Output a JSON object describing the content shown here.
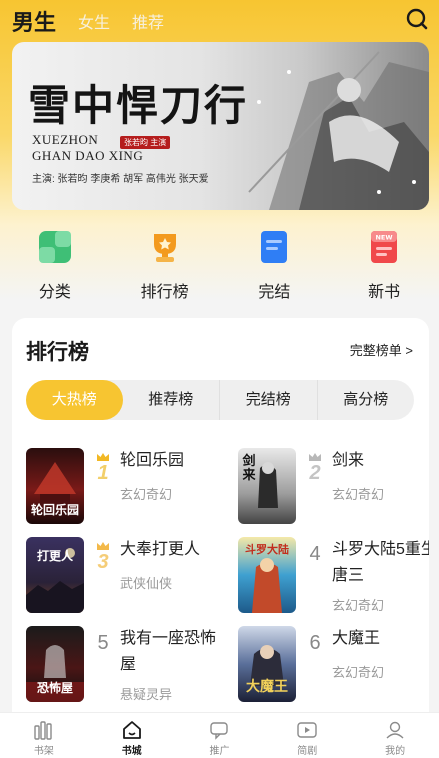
{
  "top_tabs": [
    {
      "label": "男生",
      "active": true
    },
    {
      "label": "女生",
      "active": false
    },
    {
      "label": "推荐",
      "active": false
    }
  ],
  "banner": {
    "title": "雪中悍刀行",
    "en_line1": "XUEZHON",
    "en_line2": "GHAN DAO XING",
    "stamp": "张若昀 主演",
    "cast": "主演: 张若昀 李庚希 胡军 高伟光 张天爱",
    "dots": 3,
    "active_dot": 0
  },
  "shortcuts": [
    {
      "label": "分类",
      "icon": "grid-icon",
      "color": "#3fbf76"
    },
    {
      "label": "排行榜",
      "icon": "trophy-icon",
      "color": "#f39a1e"
    },
    {
      "label": "完结",
      "icon": "document-icon",
      "color": "#2f7ef5"
    },
    {
      "label": "新书",
      "icon": "new-book-icon",
      "color": "#f0484a"
    }
  ],
  "ranking": {
    "title": "排行榜",
    "more": "完整榜单 >",
    "tabs": [
      "大热榜",
      "推荐榜",
      "完结榜",
      "高分榜"
    ],
    "active_tab": 0,
    "books": [
      {
        "rank": "1",
        "name": "轮回乐园",
        "genre": "玄幻奇幻",
        "cover_text": "轮回乐园",
        "crown": "gold"
      },
      {
        "rank": "2",
        "name": "剑来",
        "genre": "玄幻奇幻",
        "cover_text": "剑来",
        "crown": "silver"
      },
      {
        "rank": "3",
        "name": "大奉打更人",
        "genre": "武侠仙侠",
        "cover_text": "打更人",
        "crown": "bronze"
      },
      {
        "rank": "4",
        "name": "斗罗大陆5重生唐三",
        "genre": "玄幻奇幻",
        "cover_text": "斗罗大陆",
        "crown": ""
      },
      {
        "rank": "5",
        "name": "我有一座恐怖屋",
        "genre": "悬疑灵异",
        "cover_text": "恐怖屋",
        "crown": ""
      },
      {
        "rank": "6",
        "name": "大魔王",
        "genre": "玄幻奇幻",
        "cover_text": "大魔王",
        "crown": ""
      }
    ]
  },
  "navbar": [
    {
      "label": "书架",
      "icon": "bookshelf-icon",
      "active": false
    },
    {
      "label": "书城",
      "icon": "home-icon",
      "active": true
    },
    {
      "label": "推广",
      "icon": "promote-icon",
      "active": false
    },
    {
      "label": "简剧",
      "icon": "video-icon",
      "active": false
    },
    {
      "label": "我的",
      "icon": "profile-icon",
      "active": false
    }
  ],
  "colors": {
    "accent": "#f7c531",
    "gold": "#f2b824",
    "silver": "#b8b8b8",
    "bronze": "#f3b94a"
  }
}
